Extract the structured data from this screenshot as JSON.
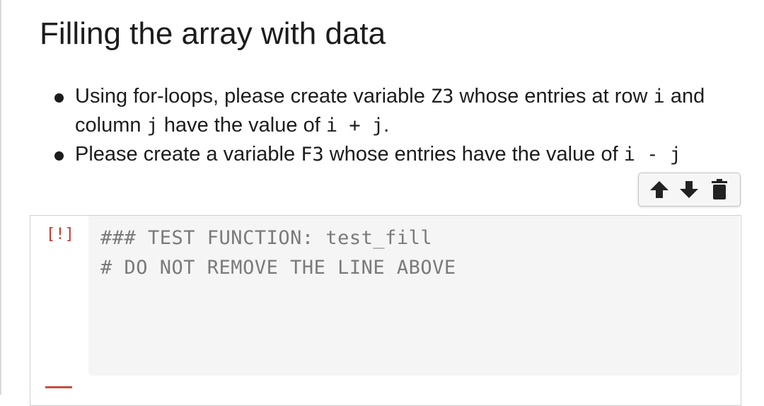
{
  "markdown": {
    "title": "Filling the array with data",
    "bullets": [
      {
        "pre": "Using for-loops, please create variable ",
        "var": "Z3",
        "mid1": " whose entries at row ",
        "i": "i",
        "mid2": " and column ",
        "j": "j",
        "mid3": " have the value of ",
        "expr": "i + j",
        "end": "."
      },
      {
        "pre": "Please create a variable ",
        "var": "F3",
        "mid": " whose entries have the value of ",
        "expr": "i - j"
      }
    ]
  },
  "toolbar": {
    "icons": [
      "arrow-up-icon",
      "arrow-down-icon",
      "trash-icon"
    ]
  },
  "code_cell": {
    "prompt": "[!]",
    "lines": [
      "### TEST FUNCTION: test_fill",
      "# DO NOT REMOVE THE LINE ABOVE"
    ]
  },
  "colors": {
    "prompt": "#c0392b",
    "code_text": "#7a7a7a",
    "editor_bg": "#f5f5f5"
  }
}
